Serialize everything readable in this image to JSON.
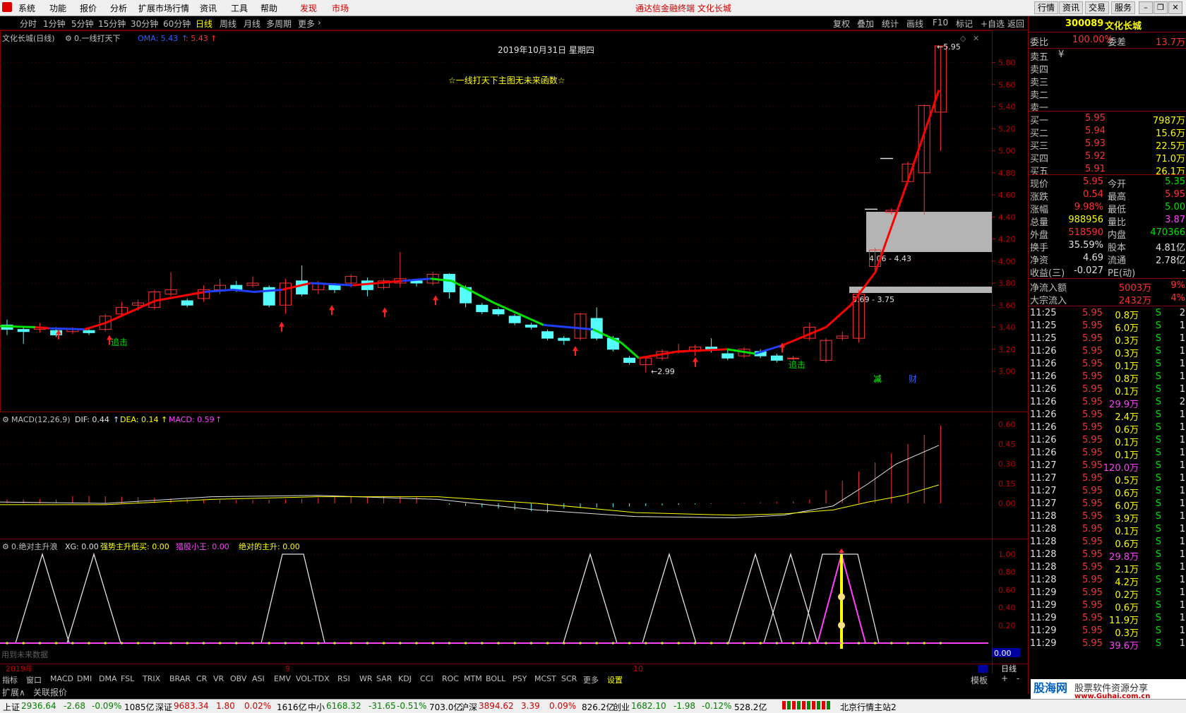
{
  "app": {
    "title": "通达信金融终端 文化长城",
    "menu": [
      "系统",
      "功能",
      "报价",
      "分析",
      "扩展市场行情",
      "资讯",
      "工具",
      "帮助"
    ],
    "menu_red": [
      "发现",
      "市场"
    ],
    "right_menu": [
      "行情",
      "资讯",
      "交易",
      "服务"
    ]
  },
  "periods": [
    "分时",
    "1分钟",
    "5分钟",
    "15分钟",
    "30分钟",
    "60分钟",
    "日线",
    "周线",
    "月线",
    "多周期",
    "更多"
  ],
  "active_period": "日线",
  "toolbar": [
    "复权",
    "叠加",
    "统计",
    "画线",
    "F10",
    "标记",
    "+自选",
    "返回"
  ],
  "chart_header": {
    "stock": "文化长城(日线)",
    "indicator": "0.一线打天下",
    "oma_label": "OMA: 5.43",
    "oma_val": ": 5.43",
    "date": "2019年10月31日  星期四",
    "notice": "☆一线打天下主图无未来函数☆"
  },
  "main_axis": [
    "5.80",
    "5.60",
    "5.40",
    "5.20",
    "5.00",
    "4.80",
    "4.60",
    "4.40",
    "4.20",
    "4.00",
    "3.80",
    "3.60",
    "3.40",
    "3.20",
    "3.00"
  ],
  "annotations": {
    "high": "5.95",
    "low": "2.99",
    "zone1": "4.06 - 4.43",
    "zone2": "3.69 - 3.75",
    "chase1": "追击",
    "chase2": "追击",
    "jian": "减",
    "cai": "财"
  },
  "macd": {
    "label": "MACD(12,26,9)",
    "dif": "DIF: 0.44",
    "dea": "DEA: 0.14",
    "macd": "MACD: 0.59",
    "axis": [
      "0.60",
      "0.45",
      "0.30",
      "0.15",
      "0.00"
    ]
  },
  "sub3": {
    "label": "0.绝对主升浪",
    "xg": "XG: 0.00",
    "s1": "强势主升低买: 0.00",
    "s2": "猎股小王: 0.00",
    "s3": "绝对的主升: 0.00",
    "axis": [
      "1.00",
      "0.80",
      "0.60",
      "0.40",
      "0.20"
    ],
    "cur": "0.00",
    "footnote": "用到未来数据"
  },
  "date_axis": {
    "y2019": "2019年",
    "m9": "9",
    "m10": "10",
    "mode": "日线"
  },
  "quote": {
    "code": "300089",
    "name": "文化长城",
    "weibi_lbl": "委比",
    "weibi": "100.00%",
    "weicha_lbl": "委差",
    "weicha": "13.7万",
    "sell": [
      {
        "lbl": "卖五",
        "p": "",
        "v": ""
      },
      {
        "lbl": "卖四",
        "p": "",
        "v": ""
      },
      {
        "lbl": "卖三",
        "p": "",
        "v": ""
      },
      {
        "lbl": "卖二",
        "p": "",
        "v": ""
      },
      {
        "lbl": "卖一",
        "p": "",
        "v": ""
      }
    ],
    "buy": [
      {
        "lbl": "买一",
        "p": "5.95",
        "v": "7987万"
      },
      {
        "lbl": "买二",
        "p": "5.94",
        "v": "15.6万"
      },
      {
        "lbl": "买三",
        "p": "5.93",
        "v": "22.5万"
      },
      {
        "lbl": "买四",
        "p": "5.92",
        "v": "71.0万"
      },
      {
        "lbl": "买五",
        "p": "5.91",
        "v": "26.1万"
      }
    ],
    "stats": [
      {
        "l1": "现价",
        "v1": "5.95",
        "c1": "red",
        "l2": "今开",
        "v2": "5.35",
        "c2": "grn"
      },
      {
        "l1": "涨跌",
        "v1": "0.54",
        "c1": "red",
        "l2": "最高",
        "v2": "5.95",
        "c2": "red"
      },
      {
        "l1": "涨幅",
        "v1": "9.98%",
        "c1": "red",
        "l2": "最低",
        "v2": "5.00",
        "c2": "grn"
      },
      {
        "l1": "总量",
        "v1": "988956",
        "c1": "yel",
        "l2": "量比",
        "v2": "3.87",
        "c2": "mag"
      },
      {
        "l1": "外盘",
        "v1": "518590",
        "c1": "red",
        "l2": "内盘",
        "v2": "470366",
        "c2": "grn"
      },
      {
        "l1": "换手",
        "v1": "35.59%",
        "c1": "wht",
        "l2": "股本",
        "v2": "4.81亿",
        "c2": "wht"
      },
      {
        "l1": "净资",
        "v1": "4.69",
        "c1": "wht",
        "l2": "流通",
        "v2": "2.78亿",
        "c2": "wht"
      },
      {
        "l1": "收益(三)",
        "v1": "-0.027",
        "c1": "wht",
        "l2": "PE(动)",
        "v2": "-",
        "c2": "wht"
      }
    ],
    "flow": [
      {
        "lbl": "净流入额",
        "v": "5003万",
        "pct": "9%"
      },
      {
        "lbl": "大宗流入",
        "v": "2432万",
        "pct": "4%"
      }
    ],
    "ticks": [
      {
        "t": "11:25",
        "p": "5.95",
        "v": "0.8万",
        "bs": "S",
        "n": "2",
        "vc": "yel"
      },
      {
        "t": "11:25",
        "p": "5.95",
        "v": "6.0万",
        "bs": "S",
        "n": "1",
        "vc": "yel"
      },
      {
        "t": "11:25",
        "p": "5.95",
        "v": "0.3万",
        "bs": "S",
        "n": "1",
        "vc": "yel"
      },
      {
        "t": "11:26",
        "p": "5.95",
        "v": "0.3万",
        "bs": "S",
        "n": "1",
        "vc": "yel"
      },
      {
        "t": "11:26",
        "p": "5.95",
        "v": "0.1万",
        "bs": "S",
        "n": "1",
        "vc": "yel"
      },
      {
        "t": "11:26",
        "p": "5.95",
        "v": "0.8万",
        "bs": "S",
        "n": "1",
        "vc": "yel"
      },
      {
        "t": "11:26",
        "p": "5.95",
        "v": "0.1万",
        "bs": "S",
        "n": "1",
        "vc": "yel"
      },
      {
        "t": "11:26",
        "p": "5.95",
        "v": "29.9万",
        "bs": "S",
        "n": "2",
        "vc": "mag"
      },
      {
        "t": "11:26",
        "p": "5.95",
        "v": "2.4万",
        "bs": "S",
        "n": "1",
        "vc": "yel"
      },
      {
        "t": "11:26",
        "p": "5.95",
        "v": "0.6万",
        "bs": "S",
        "n": "1",
        "vc": "yel"
      },
      {
        "t": "11:26",
        "p": "5.95",
        "v": "0.1万",
        "bs": "S",
        "n": "1",
        "vc": "yel"
      },
      {
        "t": "11:26",
        "p": "5.95",
        "v": "0.1万",
        "bs": "S",
        "n": "1",
        "vc": "yel"
      },
      {
        "t": "11:27",
        "p": "5.95",
        "v": "120.0万",
        "bs": "S",
        "n": "1",
        "vc": "mag"
      },
      {
        "t": "11:27",
        "p": "5.95",
        "v": "0.5万",
        "bs": "S",
        "n": "1",
        "vc": "yel"
      },
      {
        "t": "11:27",
        "p": "5.95",
        "v": "0.6万",
        "bs": "S",
        "n": "1",
        "vc": "yel"
      },
      {
        "t": "11:27",
        "p": "5.95",
        "v": "6.0万",
        "bs": "S",
        "n": "1",
        "vc": "yel"
      },
      {
        "t": "11:28",
        "p": "5.95",
        "v": "3.9万",
        "bs": "S",
        "n": "1",
        "vc": "yel"
      },
      {
        "t": "11:28",
        "p": "5.95",
        "v": "0.1万",
        "bs": "S",
        "n": "1",
        "vc": "yel"
      },
      {
        "t": "11:28",
        "p": "5.95",
        "v": "0.6万",
        "bs": "S",
        "n": "1",
        "vc": "yel"
      },
      {
        "t": "11:28",
        "p": "5.95",
        "v": "29.8万",
        "bs": "S",
        "n": "1",
        "vc": "mag"
      },
      {
        "t": "11:28",
        "p": "5.95",
        "v": "2.1万",
        "bs": "S",
        "n": "1",
        "vc": "yel"
      },
      {
        "t": "11:28",
        "p": "5.95",
        "v": "4.2万",
        "bs": "S",
        "n": "1",
        "vc": "yel"
      },
      {
        "t": "11:29",
        "p": "5.95",
        "v": "0.2万",
        "bs": "S",
        "n": "1",
        "vc": "yel"
      },
      {
        "t": "11:29",
        "p": "5.95",
        "v": "0.6万",
        "bs": "S",
        "n": "1",
        "vc": "yel"
      },
      {
        "t": "11:29",
        "p": "5.95",
        "v": "11.9万",
        "bs": "S",
        "n": "1",
        "vc": "yel"
      },
      {
        "t": "11:29",
        "p": "5.95",
        "v": "0.3万",
        "bs": "S",
        "n": "1",
        "vc": "yel"
      },
      {
        "t": "11:29",
        "p": "5.95",
        "v": "39.6万",
        "bs": "S",
        "n": "1",
        "vc": "mag"
      }
    ]
  },
  "indicators": [
    "指标",
    "窗口",
    "MACD",
    "DMI",
    "DMA",
    "FSL",
    "TRIX",
    "BRAR",
    "CR",
    "VR",
    "OBV",
    "ASI",
    "EMV",
    "VOL-TDX",
    "RSI",
    "WR",
    "SAR",
    "KDJ",
    "CCI",
    "ROC",
    "MTM",
    "BOLL",
    "PSY",
    "MCST",
    "SCR",
    "更多",
    "设置"
  ],
  "ext": [
    "扩展∧",
    "关联报价"
  ],
  "template_btn": "模板",
  "status": [
    {
      "n": "上证",
      "v": "2936.64",
      "c": "-2.68",
      "p": "-0.09%",
      "a": "1085亿"
    },
    {
      "n": "深证",
      "v": "9683.34",
      "c": "1.80",
      "p": "0.02%",
      "a": "1616亿"
    },
    {
      "n": "中小",
      "v": "6168.32",
      "c": "-31.65",
      "p": "-0.51%",
      "a": "703.0亿"
    },
    {
      "n": "沪深",
      "v": "3894.62",
      "c": "3.39",
      "p": "0.09%",
      "a": "826.2亿"
    },
    {
      "n": "创业",
      "v": "1682.10",
      "c": "-1.98",
      "p": "-0.12%",
      "a": "528.2亿"
    }
  ],
  "server": "北京行情主站2",
  "watermark": "股海网 股票软件资源分享 www.Guhai.com.cn"
}
